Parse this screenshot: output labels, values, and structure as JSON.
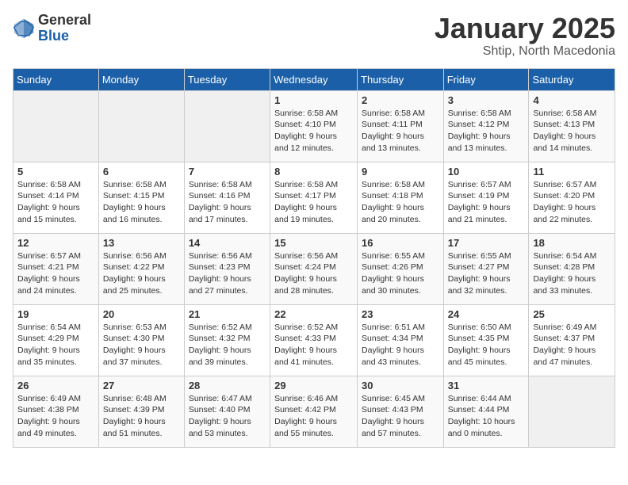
{
  "header": {
    "logo_line1": "General",
    "logo_line2": "Blue",
    "title": "January 2025",
    "subtitle": "Shtip, North Macedonia"
  },
  "weekdays": [
    "Sunday",
    "Monday",
    "Tuesday",
    "Wednesday",
    "Thursday",
    "Friday",
    "Saturday"
  ],
  "weeks": [
    [
      {
        "day": "",
        "info": ""
      },
      {
        "day": "",
        "info": ""
      },
      {
        "day": "",
        "info": ""
      },
      {
        "day": "1",
        "info": "Sunrise: 6:58 AM\nSunset: 4:10 PM\nDaylight: 9 hours and 12 minutes."
      },
      {
        "day": "2",
        "info": "Sunrise: 6:58 AM\nSunset: 4:11 PM\nDaylight: 9 hours and 13 minutes."
      },
      {
        "day": "3",
        "info": "Sunrise: 6:58 AM\nSunset: 4:12 PM\nDaylight: 9 hours and 13 minutes."
      },
      {
        "day": "4",
        "info": "Sunrise: 6:58 AM\nSunset: 4:13 PM\nDaylight: 9 hours and 14 minutes."
      }
    ],
    [
      {
        "day": "5",
        "info": "Sunrise: 6:58 AM\nSunset: 4:14 PM\nDaylight: 9 hours and 15 minutes."
      },
      {
        "day": "6",
        "info": "Sunrise: 6:58 AM\nSunset: 4:15 PM\nDaylight: 9 hours and 16 minutes."
      },
      {
        "day": "7",
        "info": "Sunrise: 6:58 AM\nSunset: 4:16 PM\nDaylight: 9 hours and 17 minutes."
      },
      {
        "day": "8",
        "info": "Sunrise: 6:58 AM\nSunset: 4:17 PM\nDaylight: 9 hours and 19 minutes."
      },
      {
        "day": "9",
        "info": "Sunrise: 6:58 AM\nSunset: 4:18 PM\nDaylight: 9 hours and 20 minutes."
      },
      {
        "day": "10",
        "info": "Sunrise: 6:57 AM\nSunset: 4:19 PM\nDaylight: 9 hours and 21 minutes."
      },
      {
        "day": "11",
        "info": "Sunrise: 6:57 AM\nSunset: 4:20 PM\nDaylight: 9 hours and 22 minutes."
      }
    ],
    [
      {
        "day": "12",
        "info": "Sunrise: 6:57 AM\nSunset: 4:21 PM\nDaylight: 9 hours and 24 minutes."
      },
      {
        "day": "13",
        "info": "Sunrise: 6:56 AM\nSunset: 4:22 PM\nDaylight: 9 hours and 25 minutes."
      },
      {
        "day": "14",
        "info": "Sunrise: 6:56 AM\nSunset: 4:23 PM\nDaylight: 9 hours and 27 minutes."
      },
      {
        "day": "15",
        "info": "Sunrise: 6:56 AM\nSunset: 4:24 PM\nDaylight: 9 hours and 28 minutes."
      },
      {
        "day": "16",
        "info": "Sunrise: 6:55 AM\nSunset: 4:26 PM\nDaylight: 9 hours and 30 minutes."
      },
      {
        "day": "17",
        "info": "Sunrise: 6:55 AM\nSunset: 4:27 PM\nDaylight: 9 hours and 32 minutes."
      },
      {
        "day": "18",
        "info": "Sunrise: 6:54 AM\nSunset: 4:28 PM\nDaylight: 9 hours and 33 minutes."
      }
    ],
    [
      {
        "day": "19",
        "info": "Sunrise: 6:54 AM\nSunset: 4:29 PM\nDaylight: 9 hours and 35 minutes."
      },
      {
        "day": "20",
        "info": "Sunrise: 6:53 AM\nSunset: 4:30 PM\nDaylight: 9 hours and 37 minutes."
      },
      {
        "day": "21",
        "info": "Sunrise: 6:52 AM\nSunset: 4:32 PM\nDaylight: 9 hours and 39 minutes."
      },
      {
        "day": "22",
        "info": "Sunrise: 6:52 AM\nSunset: 4:33 PM\nDaylight: 9 hours and 41 minutes."
      },
      {
        "day": "23",
        "info": "Sunrise: 6:51 AM\nSunset: 4:34 PM\nDaylight: 9 hours and 43 minutes."
      },
      {
        "day": "24",
        "info": "Sunrise: 6:50 AM\nSunset: 4:35 PM\nDaylight: 9 hours and 45 minutes."
      },
      {
        "day": "25",
        "info": "Sunrise: 6:49 AM\nSunset: 4:37 PM\nDaylight: 9 hours and 47 minutes."
      }
    ],
    [
      {
        "day": "26",
        "info": "Sunrise: 6:49 AM\nSunset: 4:38 PM\nDaylight: 9 hours and 49 minutes."
      },
      {
        "day": "27",
        "info": "Sunrise: 6:48 AM\nSunset: 4:39 PM\nDaylight: 9 hours and 51 minutes."
      },
      {
        "day": "28",
        "info": "Sunrise: 6:47 AM\nSunset: 4:40 PM\nDaylight: 9 hours and 53 minutes."
      },
      {
        "day": "29",
        "info": "Sunrise: 6:46 AM\nSunset: 4:42 PM\nDaylight: 9 hours and 55 minutes."
      },
      {
        "day": "30",
        "info": "Sunrise: 6:45 AM\nSunset: 4:43 PM\nDaylight: 9 hours and 57 minutes."
      },
      {
        "day": "31",
        "info": "Sunrise: 6:44 AM\nSunset: 4:44 PM\nDaylight: 10 hours and 0 minutes."
      },
      {
        "day": "",
        "info": ""
      }
    ]
  ]
}
